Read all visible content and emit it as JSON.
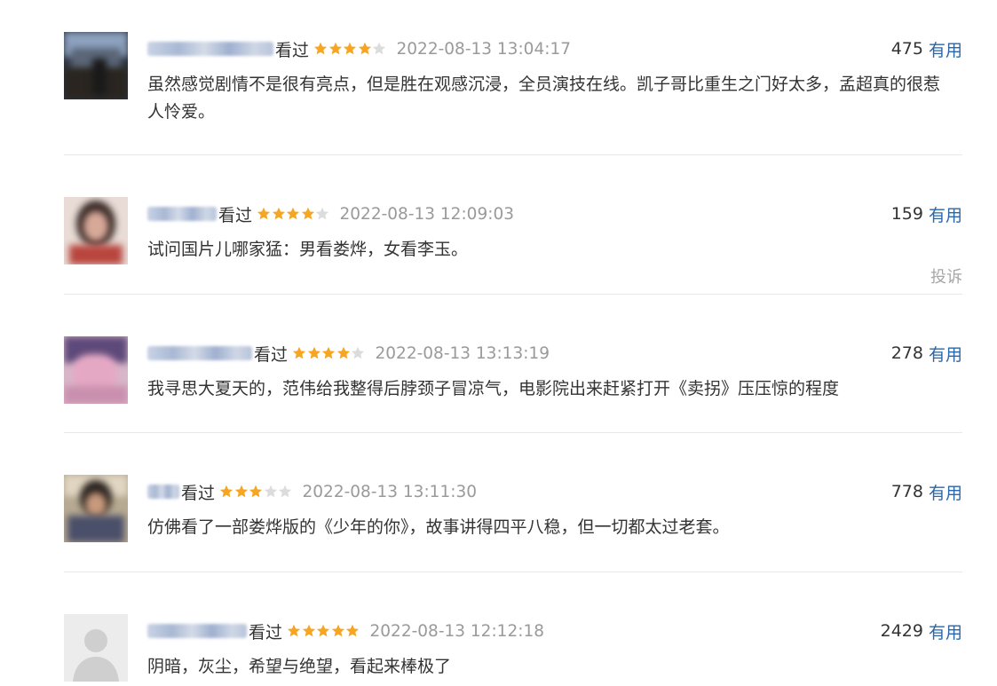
{
  "reviews": [
    {
      "watched": "看过",
      "rating": 4,
      "time": "2022-08-13 13:04:17",
      "votes": "475",
      "useful_label": "有用",
      "content": "虽然感觉剧情不是很有亮点，但是胜在观感沉浸，全员演技在线。凯子哥比重生之门好太多，孟超真的很惹人怜爱。"
    },
    {
      "watched": "看过",
      "rating": 4,
      "time": "2022-08-13 12:09:03",
      "votes": "159",
      "useful_label": "有用",
      "content": "试问国片儿哪家猛：男看娄烨，女看李玉。",
      "report_label": "投诉"
    },
    {
      "watched": "看过",
      "rating": 4,
      "time": "2022-08-13 13:13:19",
      "votes": "278",
      "useful_label": "有用",
      "content": "我寻思大夏天的，范伟给我整得后脖颈子冒凉气，电影院出来赶紧打开《卖拐》压压惊的程度"
    },
    {
      "watched": "看过",
      "rating": 3,
      "time": "2022-08-13 13:11:30",
      "votes": "778",
      "useful_label": "有用",
      "content": "仿佛看了一部娄烨版的《少年的你》，故事讲得四平八稳，但一切都太过老套。"
    },
    {
      "watched": "看过",
      "rating": 5,
      "time": "2022-08-13 12:12:18",
      "votes": "2429",
      "useful_label": "有用",
      "content": "阴暗，灰尘，希望与绝望，看起来棒极了"
    }
  ],
  "colors": {
    "star_on": "#f6a623",
    "star_off": "#dcdcdc",
    "useful_link": "#2a66a8",
    "timestamp": "#9a9a9a"
  },
  "icons": {
    "star": "star-icon",
    "avatar_default": "default-user-icon"
  }
}
